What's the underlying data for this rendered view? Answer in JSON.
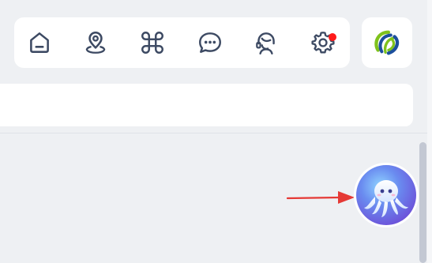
{
  "toolbar": {
    "items": [
      {
        "icon": "home-icon"
      },
      {
        "icon": "location-pin-icon"
      },
      {
        "icon": "command-icon"
      },
      {
        "icon": "chat-bubble-icon"
      },
      {
        "icon": "customer-service-icon"
      },
      {
        "icon": "gear-icon",
        "has_notification": true
      }
    ],
    "icon_color": "#3d4a63",
    "notification_color": "#ff1a1a"
  },
  "logo": {
    "icon": "brand-logo-icon",
    "colors": [
      "#1c4f9c",
      "#7fc21c"
    ]
  },
  "search": {
    "value": ""
  },
  "annotation": {
    "icon": "red-arrow-icon",
    "color": "#e53935"
  },
  "assistant": {
    "icon": "octopus-assistant-icon",
    "colors": [
      "#6c5ce7",
      "#67b7f7"
    ]
  }
}
